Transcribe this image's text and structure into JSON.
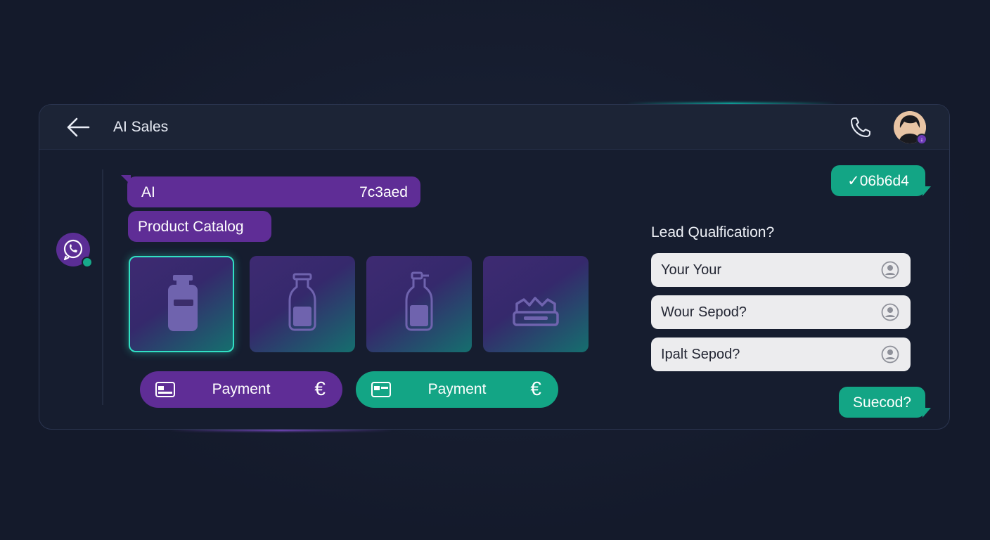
{
  "header": {
    "title": "AI Sales",
    "back_icon": "arrow-left-icon",
    "phone_icon": "phone-icon"
  },
  "chat": {
    "ai_bubble": {
      "left": "AI",
      "right": "7c3aed"
    },
    "catalog_label": "Product Catalog",
    "products": [
      {
        "icon": "jar-icon",
        "selected": true
      },
      {
        "icon": "bottle-icon",
        "selected": false
      },
      {
        "icon": "spray-bottle-icon",
        "selected": false
      },
      {
        "icon": "container-icon",
        "selected": false
      }
    ],
    "payments": [
      {
        "label": "Payment",
        "currency": "€",
        "color": "#5f2d96"
      },
      {
        "label": "Payment",
        "currency": "€",
        "color": "#13a585"
      }
    ]
  },
  "right": {
    "top_bubble": "✓06b6d4",
    "lead_title": "Lead Qualfication?",
    "options": [
      {
        "label": "Your Your"
      },
      {
        "label": "Wour Sepod?"
      },
      {
        "label": "Ipalt Sepod?"
      }
    ],
    "bottom_bubble": "Suecod?"
  },
  "colors": {
    "purple": "#5f2d96",
    "green": "#13a585",
    "background": "#141a2b",
    "accent_teal": "#31e0c4"
  }
}
